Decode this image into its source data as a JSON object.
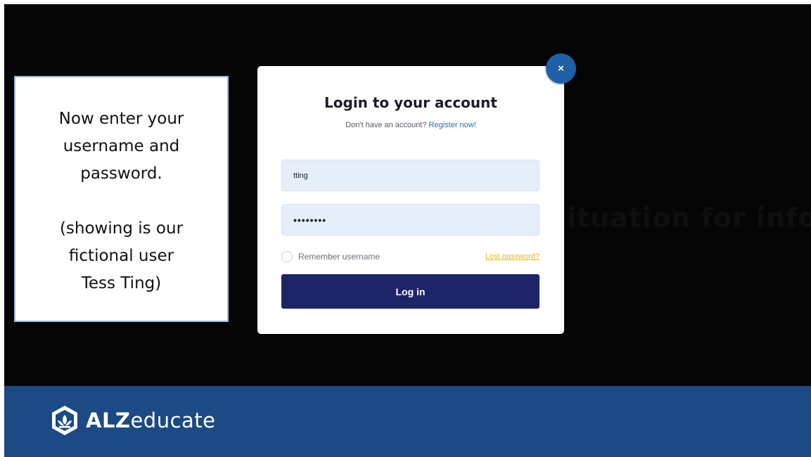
{
  "instruction": {
    "text": "Now enter your\nusername and\npassword.\n\n(showing is our\nfictional user\nTess Ting)"
  },
  "background": {
    "ghost_text": "ituation for info"
  },
  "modal": {
    "close_label": "×",
    "title": "Login to your account",
    "subtitle_prefix": "Don't have an account?",
    "register_link": "Register now!",
    "username_value": "tting",
    "password_value": "••••••••",
    "remember_label": "Remember username",
    "lost_password_link": "Lost password?",
    "login_button": "Log in"
  },
  "footer": {
    "brand_bold": "ALZ",
    "brand_rest": "educate",
    "logo_icon": "alzeducate-logo-icon"
  },
  "colors": {
    "accent_blue": "#1f5fa8",
    "footer_blue": "#1b4a84",
    "login_button": "#1d2468",
    "link_yellow": "#e3b90f"
  }
}
